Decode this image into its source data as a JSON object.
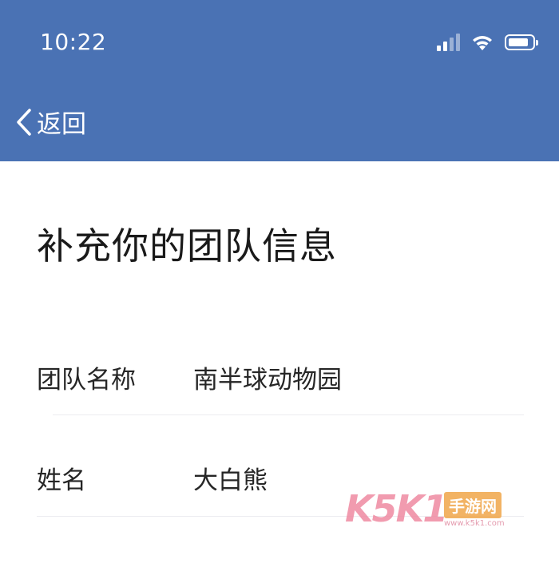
{
  "status_bar": {
    "time": "10:22",
    "signal_level": 2,
    "signal_max": 4,
    "battery_level": 0.85
  },
  "nav": {
    "back_label": "返回"
  },
  "page": {
    "title": "补充你的团队信息"
  },
  "form": {
    "fields": [
      {
        "label": "团队名称",
        "value": "南半球动物园"
      },
      {
        "label": "姓名",
        "value": "大白熊"
      }
    ]
  },
  "watermark": {
    "brand": "K5K1",
    "tagline": "手游网",
    "url": "www.k5k1.com"
  },
  "colors": {
    "header_bg": "#4a72b4",
    "text_primary": "#1a1a1a",
    "divider": "#ececf0"
  }
}
